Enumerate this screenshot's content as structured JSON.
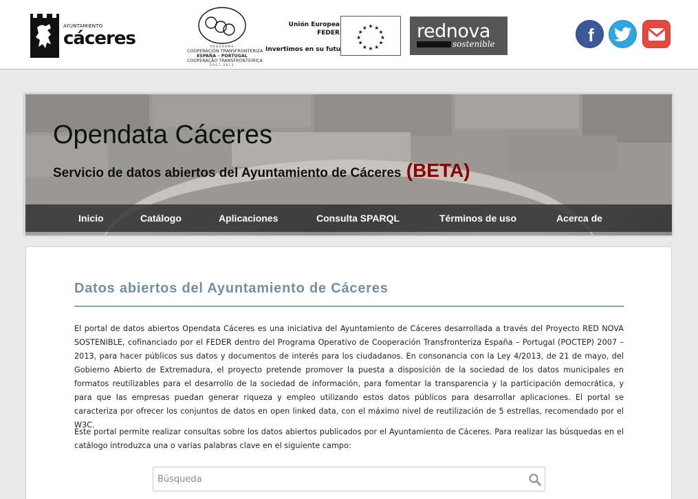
{
  "header": {
    "caceres_logo": {
      "small_text": "AYUNTAMIENTO",
      "big_text": "cáceres"
    },
    "poctep_logo": {
      "line_programa": "PROGRAMA",
      "line1": "COOPERACIÓN TRANSFRONTERIZA",
      "line2": "ESPAÑA – PORTUGAL",
      "line3": "COOPERAÇÃO TRANSFRONTEIRIÇA",
      "line_years": "2007-2013"
    },
    "eu_logo": {
      "line1": "Unión Europea",
      "line2": "FEDER",
      "line3": "Invertimos en su futuro"
    },
    "rednova_logo": {
      "word": "rednova",
      "sub": "sostenible"
    },
    "social": {
      "facebook": "f"
    }
  },
  "hero": {
    "title": "Opendata Cáceres",
    "subtitle": "Servicio de datos abiertos del Ayuntamiento de Cáceres",
    "beta": "(BETA)"
  },
  "nav": {
    "items": [
      "Inicio",
      "Catálogo",
      "Aplicaciones",
      "Consulta SPARQL",
      "Términos de uso",
      "Acerca de"
    ]
  },
  "main": {
    "heading": "Datos abiertos del Ayuntamiento de Cáceres",
    "paragraph1": "El portal de datos abiertos Opendata Cáceres es una iniciativa del Ayuntamiento de Cáceres desarrollada a través del Proyecto RED NOVA SOSTENIBLE, cofinanciado por el FEDER dentro del Programa Operativo de Cooperación Transfronteriza España – Portugal (POCTEP) 2007 – 2013, para hacer públicos sus datos y documentos de interés para los ciudadanos. En consonancia con la Ley 4/2013, de 21 de mayo, del Gobierno Abierto de Extremadura, el proyecto pretende promover la puesta a disposición de la sociedad de los datos municipales en formatos reutilizables para el desarrollo de la sociedad de información, para fomentar la transparencia y la participación democrática, y para que las empresas puedan generar riqueza y empleo utilizando estos datos públicos para desarrollar aplicaciones. El portal se caracteriza por ofrecer los conjuntos de datos en open linked data, con el máximo nivel de reutilización de 5 estrellas, recomendado por el W3C.",
    "paragraph2": "Este portal permite realizar consultas sobre los datos abiertos publicados por el Ayuntamiento de Cáceres. Para realizar las búsquedas en el catálogo introduzca una o varias palabras clave en el siguiente campo:",
    "search": {
      "placeholder": "Búsqueda",
      "value": ""
    }
  }
}
